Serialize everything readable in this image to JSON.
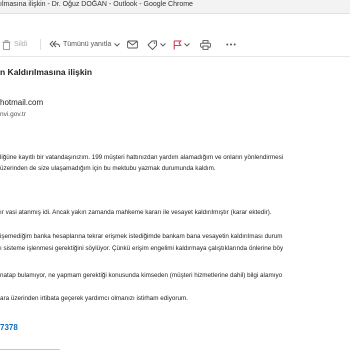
{
  "window": {
    "title": "ılmasına ilişkin - Dr. Oğuz DOĞAN - Outlook - Google Chrome"
  },
  "toolbar": {
    "delete_label": "Sildi",
    "reply_all_label": "Tümünü yanıtla"
  },
  "email": {
    "subject": "n Kaldırılmasına ilişkin",
    "sender_email": "hotmail.com",
    "recipient_domain": "nvi.gov.tr",
    "phone": "7378",
    "body": [
      "liğüne kayıtlı bir vatandaşınızım. 199 müşteri hattınızdan yardım alamadığım ve onların yönlendirmesi",
      "üzerinden de size ulaşamadığım için bu mektubu yazmak durumunda kaldım.",
      "ır vasi atanmış idi. Ancak yakın zamanda mahkeme kararı ile vesayet kaldırılmıştır (karar ektedir).",
      "işemediğim banka hesaplarına tekrar erişmek istediğimde bankam bana vesayetin kaldırılması durum",
      "ı sisteme işlenmesi gerektiğini söylüyor. Çünkü erişim engelimi kaldırmaya çalıştıklarında önlerine böy",
      "natap bulamıyor, ne yapmam gerektiği konusunda kimseden (müşteri hizmetlerine dahil) bilgi alamıyo",
      "ara üzerinden irtibata geçerek yardımcı olmanızı istirham ediyorum."
    ]
  },
  "colors": {
    "accent": "#0f6cbd",
    "flag": "#c4314b"
  },
  "icons": [
    "delete-icon",
    "reply-all-icon",
    "chevron-down-icon",
    "mark-unread-icon",
    "tag-icon",
    "flag-icon",
    "print-icon",
    "more-icon"
  ]
}
